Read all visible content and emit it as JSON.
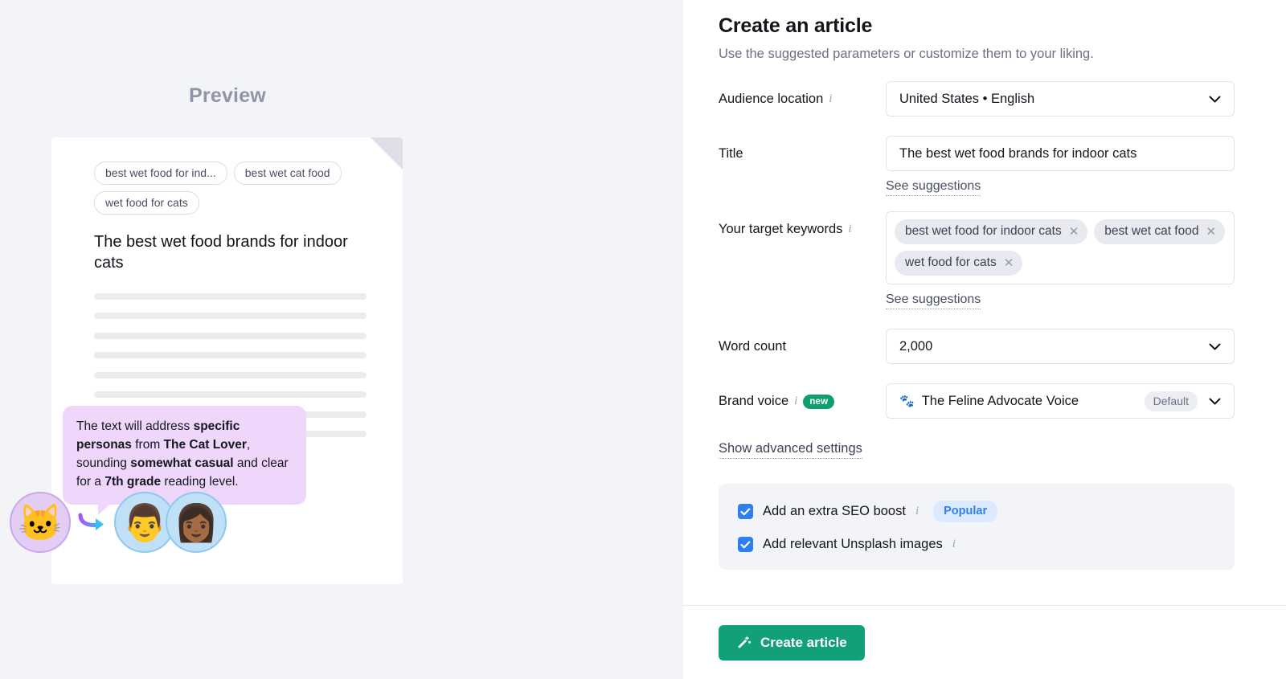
{
  "preview": {
    "heading": "Preview",
    "keyword_chips": [
      "best wet food for ind...",
      "best wet cat food",
      "wet food for cats"
    ],
    "article_title": "The best wet food brands for indoor cats",
    "skeleton_line_count": 8,
    "tooltip": {
      "part1": "The text will address ",
      "bold1": "specific personas",
      "part2": " from ",
      "bold2": "The Cat Lover",
      "part3": ", sounding ",
      "bold3": "somewhat casual",
      "part4": " and clear for a ",
      "bold4": "7th grade",
      "part5": " reading level."
    },
    "avatars": {
      "source": "cat-avatar",
      "source_glyph": "🐱",
      "arrow": "curved-arrow-icon",
      "person1": "👨",
      "person2": "👩🏾"
    },
    "colors": {
      "panel_bg": "#f3f4f8",
      "tooltip_bg": "#eed7fa",
      "fold": "#dedfe8"
    }
  },
  "form": {
    "title": "Create an article",
    "subtitle": "Use the suggested parameters or customize them to your liking.",
    "audience": {
      "label": "Audience location",
      "info_icon": "info-icon",
      "value": "United States • English"
    },
    "title_field": {
      "label": "Title",
      "value": "The best wet food brands for indoor cats",
      "suggestions_link": "See suggestions"
    },
    "keywords": {
      "label": "Your target keywords",
      "info_icon": "info-icon",
      "tags": [
        "best wet food for indoor cats",
        "best wet cat food",
        "wet food for cats"
      ],
      "remove_icon": "close-icon",
      "suggestions_link": "See suggestions"
    },
    "word_count": {
      "label": "Word count",
      "value": "2,000"
    },
    "brand_voice": {
      "label": "Brand voice",
      "info_icon": "info-icon",
      "badge": "new",
      "icon": "paw-prints-icon",
      "value": "The Feline Advocate Voice",
      "default_pill": "Default"
    },
    "advanced_link": "Show advanced settings",
    "options": [
      {
        "label": "Add an extra SEO boost",
        "checked": true,
        "info_icon": "info-icon",
        "badge": "Popular"
      },
      {
        "label": "Add relevant Unsplash images",
        "checked": true,
        "info_icon": "info-icon",
        "badge": ""
      }
    ],
    "submit": {
      "label": "Create article",
      "icon": "magic-wand-icon",
      "color": "#11a07a"
    },
    "colors": {
      "accent_green": "#11a07a",
      "checkbox_blue": "#2f7ff0",
      "badge_popular_bg": "#dbeafe",
      "badge_new_bg": "#0e9f6e"
    }
  }
}
